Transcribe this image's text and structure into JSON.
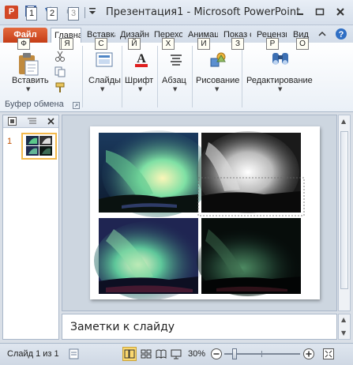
{
  "window": {
    "app_icon": "P",
    "title": "Презентация1  -  Microsoft PowerPoint",
    "qat_keytips": [
      "1",
      "2",
      "3"
    ]
  },
  "tabs": [
    {
      "label": "Файл",
      "keytip": "Ф"
    },
    {
      "label": "Главная",
      "keytip": "Я"
    },
    {
      "label": "Вставка",
      "keytip": "С"
    },
    {
      "label": "Дизайн",
      "keytip": "Й"
    },
    {
      "label": "Переходы",
      "keytip": "Х"
    },
    {
      "label": "Анимация",
      "keytip": "И"
    },
    {
      "label": "Показ слайдов",
      "keytip": "З"
    },
    {
      "label": "Рецензирование",
      "keytip": "Р"
    },
    {
      "label": "Вид",
      "keytip": "О"
    }
  ],
  "ribbon": {
    "paste_label": "Вставить",
    "clipboard_group": "Буфер обмена",
    "slides_label": "Слайды",
    "font_label": "Шрифт",
    "paragraph_label": "Абзац",
    "drawing_label": "Рисование",
    "editing_label": "Редактирование"
  },
  "thumbnails": {
    "slide_number": "1"
  },
  "notes": {
    "placeholder": "Заметки к слайду"
  },
  "status": {
    "slide_info": "Слайд 1 из 1",
    "zoom": "30%"
  },
  "colors": {
    "file_tab": "#c53d16",
    "selection_border": "#f3b94c",
    "ribbon_bg": "#eaf0f7"
  }
}
